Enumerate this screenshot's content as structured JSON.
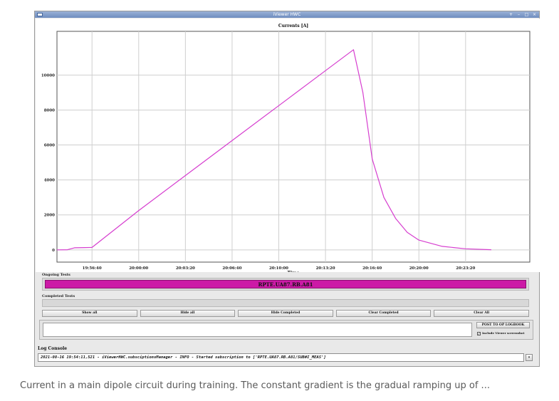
{
  "window": {
    "title": "iViewer HWC"
  },
  "chart_data": {
    "type": "line",
    "title": "Currents [A]",
    "xlabel": "Time",
    "ylabel": "",
    "x_ticks": [
      "19:56:40",
      "20:00:00",
      "20:03:20",
      "20:06:40",
      "20:10:00",
      "20:13:20",
      "20:16:40",
      "20:20:00",
      "20:23:20"
    ],
    "y_ticks": [
      0,
      2000,
      4000,
      6000,
      8000,
      10000
    ],
    "ylim": [
      -700,
      12500
    ],
    "xlim_seconds_rel_first_tick": [
      -150,
      1875
    ],
    "grid": true,
    "series": [
      {
        "color": "#d63ecf",
        "points": [
          [
            "19:54:10",
            0
          ],
          [
            "19:54:55",
            10
          ],
          [
            "19:55:25",
            120
          ],
          [
            "19:56:10",
            130
          ],
          [
            "19:56:40",
            140
          ],
          [
            "20:00:00",
            2250
          ],
          [
            "20:03:20",
            4250
          ],
          [
            "20:06:40",
            6250
          ],
          [
            "20:10:00",
            8250
          ],
          [
            "20:13:20",
            10250
          ],
          [
            "20:15:20",
            11450
          ],
          [
            "20:16:00",
            9000
          ],
          [
            "20:16:40",
            5200
          ],
          [
            "20:17:30",
            3000
          ],
          [
            "20:18:20",
            1800
          ],
          [
            "20:19:10",
            1000
          ],
          [
            "20:20:00",
            560
          ],
          [
            "20:21:40",
            200
          ],
          [
            "20:23:20",
            60
          ],
          [
            "20:25:10",
            10
          ]
        ]
      }
    ]
  },
  "tests": {
    "ongoing_label": "Ongoing Tests",
    "ongoing_item": "RPTE.UA87.RB.A81",
    "completed_label": "Completed Tests"
  },
  "buttons": {
    "show_all": "Show all",
    "hide_all": "Hide all",
    "hide_completed": "Hide Completed",
    "clear_completed": "Clear Completed",
    "clear_all": "Clear All",
    "post_logbook": "POST TO OP LOGBOOK"
  },
  "post": {
    "include_screenshot_label": "Include Viewer screenshot",
    "include_screenshot_checked": "✓"
  },
  "log": {
    "label": "Log Console",
    "line": "2021-08-16 19:54:11,521 - iViewerHWC.subsciptionsManager - INFO - Started subscription to ['RPTE.UA87.RB.A81/SUB#I_MEAS']"
  },
  "caption": "Current in a main dipole circuit during training. The constant gradient is the gradual ramping up of ..."
}
